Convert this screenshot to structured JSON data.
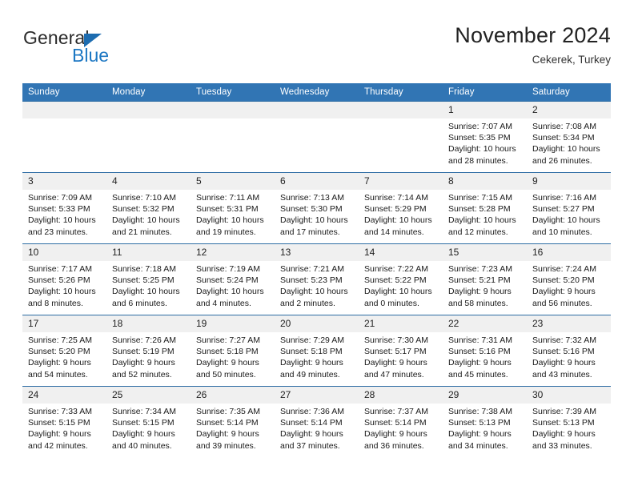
{
  "brand": {
    "name_top": "General",
    "name_bottom": "Blue"
  },
  "header": {
    "title": "November 2024",
    "subtitle": "Cekerek, Turkey"
  },
  "colors": {
    "header_blue": "#3175b4",
    "row_divider": "#2e6da4",
    "daynum_bg": "#f0f0f0",
    "brand_blue": "#1c77c3"
  },
  "calendar": {
    "weekdays": [
      "Sunday",
      "Monday",
      "Tuesday",
      "Wednesday",
      "Thursday",
      "Friday",
      "Saturday"
    ],
    "weeks": [
      [
        {
          "day": "",
          "sunrise": "",
          "sunset": "",
          "daylight": "",
          "daylight2": ""
        },
        {
          "day": "",
          "sunrise": "",
          "sunset": "",
          "daylight": "",
          "daylight2": ""
        },
        {
          "day": "",
          "sunrise": "",
          "sunset": "",
          "daylight": "",
          "daylight2": ""
        },
        {
          "day": "",
          "sunrise": "",
          "sunset": "",
          "daylight": "",
          "daylight2": ""
        },
        {
          "day": "",
          "sunrise": "",
          "sunset": "",
          "daylight": "",
          "daylight2": ""
        },
        {
          "day": "1",
          "sunrise": "Sunrise: 7:07 AM",
          "sunset": "Sunset: 5:35 PM",
          "daylight": "Daylight: 10 hours",
          "daylight2": "and 28 minutes."
        },
        {
          "day": "2",
          "sunrise": "Sunrise: 7:08 AM",
          "sunset": "Sunset: 5:34 PM",
          "daylight": "Daylight: 10 hours",
          "daylight2": "and 26 minutes."
        }
      ],
      [
        {
          "day": "3",
          "sunrise": "Sunrise: 7:09 AM",
          "sunset": "Sunset: 5:33 PM",
          "daylight": "Daylight: 10 hours",
          "daylight2": "and 23 minutes."
        },
        {
          "day": "4",
          "sunrise": "Sunrise: 7:10 AM",
          "sunset": "Sunset: 5:32 PM",
          "daylight": "Daylight: 10 hours",
          "daylight2": "and 21 minutes."
        },
        {
          "day": "5",
          "sunrise": "Sunrise: 7:11 AM",
          "sunset": "Sunset: 5:31 PM",
          "daylight": "Daylight: 10 hours",
          "daylight2": "and 19 minutes."
        },
        {
          "day": "6",
          "sunrise": "Sunrise: 7:13 AM",
          "sunset": "Sunset: 5:30 PM",
          "daylight": "Daylight: 10 hours",
          "daylight2": "and 17 minutes."
        },
        {
          "day": "7",
          "sunrise": "Sunrise: 7:14 AM",
          "sunset": "Sunset: 5:29 PM",
          "daylight": "Daylight: 10 hours",
          "daylight2": "and 14 minutes."
        },
        {
          "day": "8",
          "sunrise": "Sunrise: 7:15 AM",
          "sunset": "Sunset: 5:28 PM",
          "daylight": "Daylight: 10 hours",
          "daylight2": "and 12 minutes."
        },
        {
          "day": "9",
          "sunrise": "Sunrise: 7:16 AM",
          "sunset": "Sunset: 5:27 PM",
          "daylight": "Daylight: 10 hours",
          "daylight2": "and 10 minutes."
        }
      ],
      [
        {
          "day": "10",
          "sunrise": "Sunrise: 7:17 AM",
          "sunset": "Sunset: 5:26 PM",
          "daylight": "Daylight: 10 hours",
          "daylight2": "and 8 minutes."
        },
        {
          "day": "11",
          "sunrise": "Sunrise: 7:18 AM",
          "sunset": "Sunset: 5:25 PM",
          "daylight": "Daylight: 10 hours",
          "daylight2": "and 6 minutes."
        },
        {
          "day": "12",
          "sunrise": "Sunrise: 7:19 AM",
          "sunset": "Sunset: 5:24 PM",
          "daylight": "Daylight: 10 hours",
          "daylight2": "and 4 minutes."
        },
        {
          "day": "13",
          "sunrise": "Sunrise: 7:21 AM",
          "sunset": "Sunset: 5:23 PM",
          "daylight": "Daylight: 10 hours",
          "daylight2": "and 2 minutes."
        },
        {
          "day": "14",
          "sunrise": "Sunrise: 7:22 AM",
          "sunset": "Sunset: 5:22 PM",
          "daylight": "Daylight: 10 hours",
          "daylight2": "and 0 minutes."
        },
        {
          "day": "15",
          "sunrise": "Sunrise: 7:23 AM",
          "sunset": "Sunset: 5:21 PM",
          "daylight": "Daylight: 9 hours",
          "daylight2": "and 58 minutes."
        },
        {
          "day": "16",
          "sunrise": "Sunrise: 7:24 AM",
          "sunset": "Sunset: 5:20 PM",
          "daylight": "Daylight: 9 hours",
          "daylight2": "and 56 minutes."
        }
      ],
      [
        {
          "day": "17",
          "sunrise": "Sunrise: 7:25 AM",
          "sunset": "Sunset: 5:20 PM",
          "daylight": "Daylight: 9 hours",
          "daylight2": "and 54 minutes."
        },
        {
          "day": "18",
          "sunrise": "Sunrise: 7:26 AM",
          "sunset": "Sunset: 5:19 PM",
          "daylight": "Daylight: 9 hours",
          "daylight2": "and 52 minutes."
        },
        {
          "day": "19",
          "sunrise": "Sunrise: 7:27 AM",
          "sunset": "Sunset: 5:18 PM",
          "daylight": "Daylight: 9 hours",
          "daylight2": "and 50 minutes."
        },
        {
          "day": "20",
          "sunrise": "Sunrise: 7:29 AM",
          "sunset": "Sunset: 5:18 PM",
          "daylight": "Daylight: 9 hours",
          "daylight2": "and 49 minutes."
        },
        {
          "day": "21",
          "sunrise": "Sunrise: 7:30 AM",
          "sunset": "Sunset: 5:17 PM",
          "daylight": "Daylight: 9 hours",
          "daylight2": "and 47 minutes."
        },
        {
          "day": "22",
          "sunrise": "Sunrise: 7:31 AM",
          "sunset": "Sunset: 5:16 PM",
          "daylight": "Daylight: 9 hours",
          "daylight2": "and 45 minutes."
        },
        {
          "day": "23",
          "sunrise": "Sunrise: 7:32 AM",
          "sunset": "Sunset: 5:16 PM",
          "daylight": "Daylight: 9 hours",
          "daylight2": "and 43 minutes."
        }
      ],
      [
        {
          "day": "24",
          "sunrise": "Sunrise: 7:33 AM",
          "sunset": "Sunset: 5:15 PM",
          "daylight": "Daylight: 9 hours",
          "daylight2": "and 42 minutes."
        },
        {
          "day": "25",
          "sunrise": "Sunrise: 7:34 AM",
          "sunset": "Sunset: 5:15 PM",
          "daylight": "Daylight: 9 hours",
          "daylight2": "and 40 minutes."
        },
        {
          "day": "26",
          "sunrise": "Sunrise: 7:35 AM",
          "sunset": "Sunset: 5:14 PM",
          "daylight": "Daylight: 9 hours",
          "daylight2": "and 39 minutes."
        },
        {
          "day": "27",
          "sunrise": "Sunrise: 7:36 AM",
          "sunset": "Sunset: 5:14 PM",
          "daylight": "Daylight: 9 hours",
          "daylight2": "and 37 minutes."
        },
        {
          "day": "28",
          "sunrise": "Sunrise: 7:37 AM",
          "sunset": "Sunset: 5:14 PM",
          "daylight": "Daylight: 9 hours",
          "daylight2": "and 36 minutes."
        },
        {
          "day": "29",
          "sunrise": "Sunrise: 7:38 AM",
          "sunset": "Sunset: 5:13 PM",
          "daylight": "Daylight: 9 hours",
          "daylight2": "and 34 minutes."
        },
        {
          "day": "30",
          "sunrise": "Sunrise: 7:39 AM",
          "sunset": "Sunset: 5:13 PM",
          "daylight": "Daylight: 9 hours",
          "daylight2": "and 33 minutes."
        }
      ]
    ]
  }
}
